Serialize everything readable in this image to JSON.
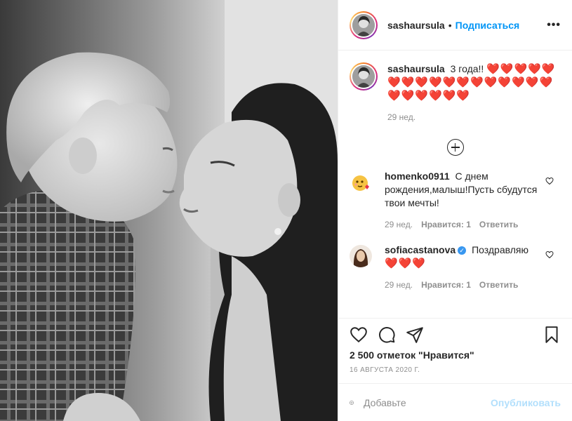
{
  "post": {
    "username": "sashaursula",
    "separator": "•",
    "follow_label": "Подписаться",
    "more_label": "•••",
    "caption_text": "3 года!!",
    "caption_hearts": "❤️❤️❤️❤️❤️❤️❤️❤️❤️❤️❤️❤️❤️❤️❤️❤️❤️❤️❤️❤️❤️❤️❤️",
    "caption_time": "29 нед."
  },
  "comments": [
    {
      "username": "homenko0911",
      "text": "С днем рождения,малыш!Пусть сбудутся твои мечты!",
      "time": "29 нед.",
      "likes": "Нравится: 1",
      "reply": "Ответить"
    },
    {
      "username": "sofiacastanova",
      "text": "Поздравляю",
      "hearts": "❤️❤️❤️",
      "time": "29 нед.",
      "likes": "Нравится: 1",
      "reply": "Ответить"
    }
  ],
  "footer": {
    "likes_count": "2 500 отметок \"Нравится\"",
    "date": "16 АВГУСТА 2020 Г.",
    "add_placeholder": "Добавьте",
    "publish_label": "Опубликовать"
  },
  "colors": {
    "accent": "#0095f6",
    "publish_disabled": "#b2dffc",
    "heart": "#ed2a3d",
    "muted": "#8e8e8e"
  },
  "icons": [
    "heart-icon",
    "comment-icon",
    "share-icon",
    "bookmark-icon",
    "emoji-icon",
    "load-more-icon",
    "more-options-icon",
    "verified-icon"
  ]
}
